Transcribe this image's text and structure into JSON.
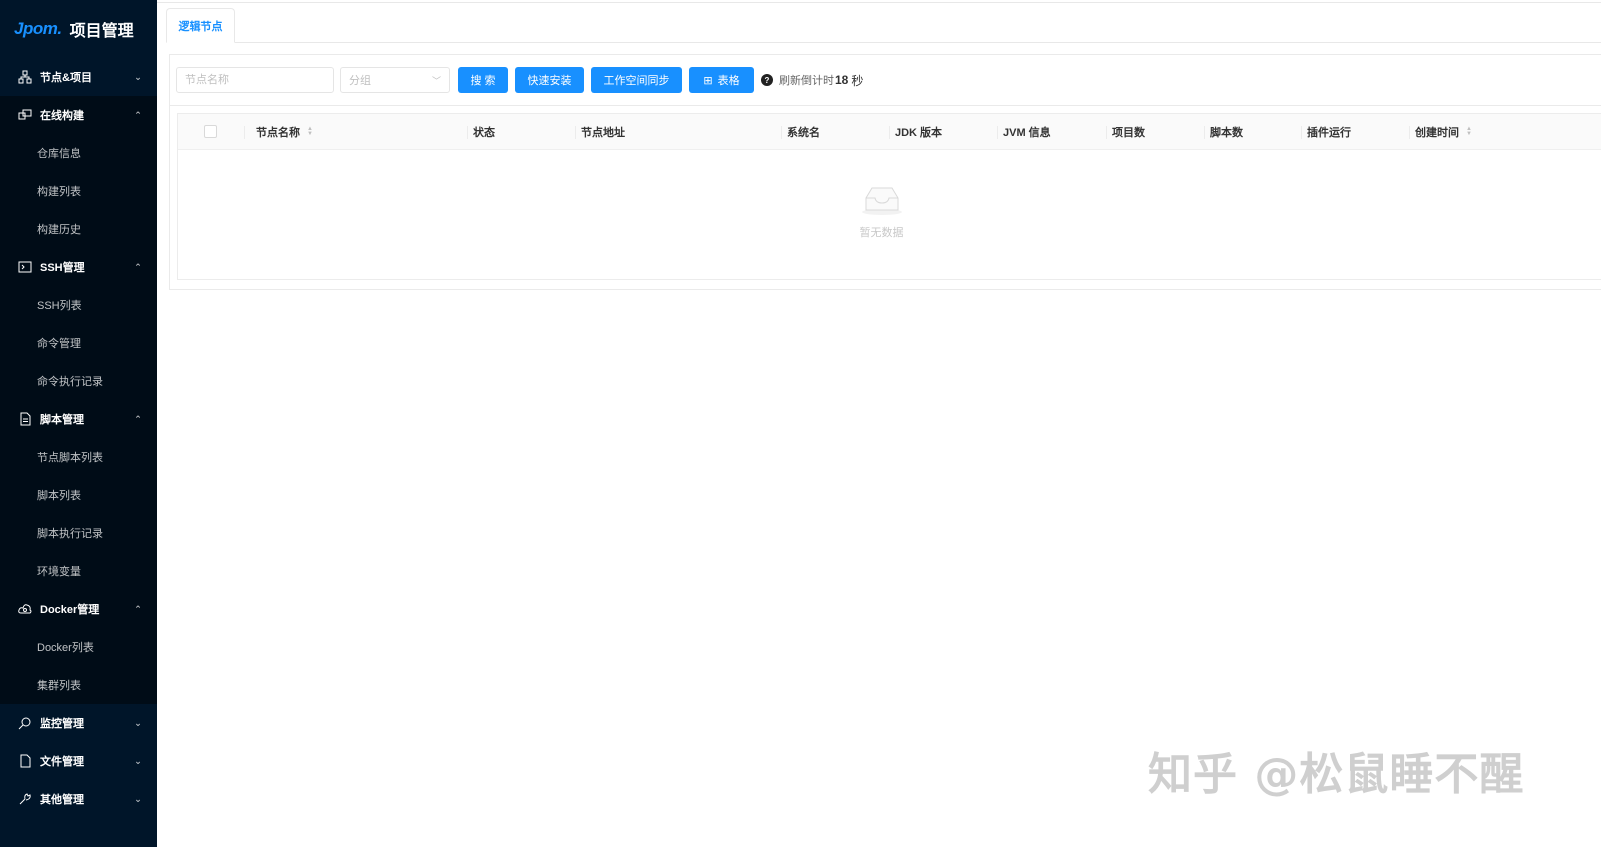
{
  "app": {
    "logo": "Jpom.",
    "title": "项目管理"
  },
  "sidebar": {
    "groups": [
      {
        "label": "节点&项目",
        "icon": "cluster-icon",
        "arrow": "⌄",
        "items": []
      },
      {
        "label": "在线构建",
        "icon": "build-icon",
        "arrow": "⌃",
        "items": [
          "仓库信息",
          "构建列表",
          "构建历史"
        ]
      },
      {
        "label": "SSH管理",
        "icon": "terminal-icon",
        "arrow": "⌃",
        "items": [
          "SSH列表",
          "命令管理",
          "命令执行记录"
        ]
      },
      {
        "label": "脚本管理",
        "icon": "file-text-icon",
        "arrow": "⌃",
        "items": [
          "节点脚本列表",
          "脚本列表",
          "脚本执行记录",
          "环境变量"
        ]
      },
      {
        "label": "Docker管理",
        "icon": "cloud-icon",
        "arrow": "⌃",
        "items": [
          "Docker列表",
          "集群列表"
        ]
      },
      {
        "label": "监控管理",
        "icon": "monitor-icon",
        "arrow": "⌄",
        "items": []
      },
      {
        "label": "文件管理",
        "icon": "file-icon",
        "arrow": "⌄",
        "items": []
      },
      {
        "label": "其他管理",
        "icon": "tool-icon",
        "arrow": "⌄",
        "items": []
      }
    ]
  },
  "tabs": [
    {
      "label": "逻辑节点",
      "active": true
    }
  ],
  "toolbar": {
    "search_placeholder": "节点名称",
    "group_placeholder": "分组",
    "search_button": "搜 索",
    "install_button": "快速安装",
    "sync_button": "工作空间同步",
    "table_button": "表格",
    "refresh_prefix": "刷新倒计时",
    "refresh_count": "18",
    "refresh_unit": "秒"
  },
  "table": {
    "columns": [
      {
        "label": "节点名称",
        "sortable": true
      },
      {
        "label": "状态",
        "sortable": false
      },
      {
        "label": "节点地址",
        "sortable": false
      },
      {
        "label": "系统名",
        "sortable": false
      },
      {
        "label": "JDK 版本",
        "sortable": false
      },
      {
        "label": "JVM 信息",
        "sortable": false
      },
      {
        "label": "项目数",
        "sortable": false
      },
      {
        "label": "脚本数",
        "sortable": false
      },
      {
        "label": "插件运行",
        "sortable": false
      },
      {
        "label": "创建时间",
        "sortable": true
      }
    ],
    "empty_text": "暂无数据",
    "rows": []
  },
  "watermark": "知乎 @松鼠睡不醒",
  "colors": {
    "sidebar_bg": "#001529",
    "submenu_bg": "#000c17",
    "primary": "#1890ff"
  }
}
